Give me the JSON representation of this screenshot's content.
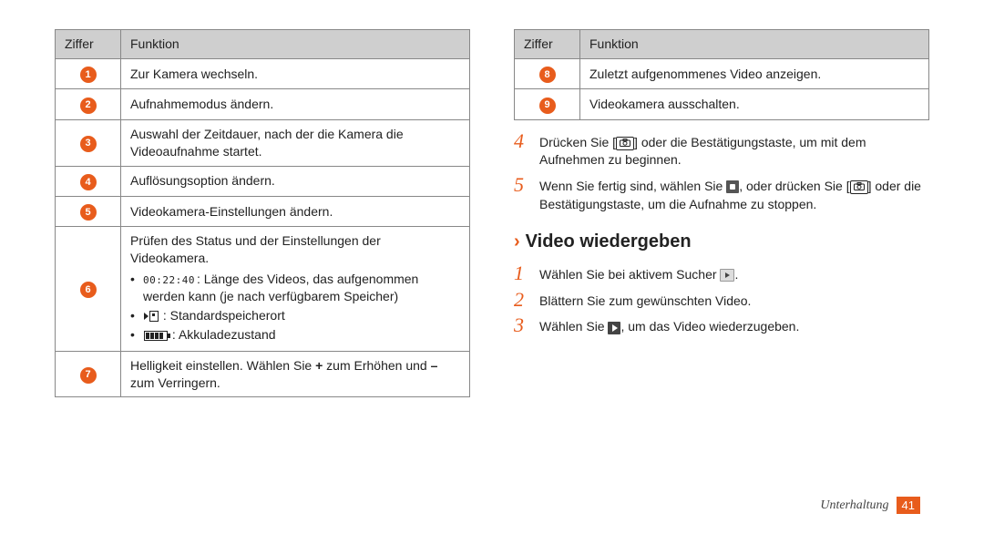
{
  "table_header": {
    "col1": "Ziffer",
    "col2": "Funktion"
  },
  "left_rows": [
    {
      "num": "1",
      "text": "Zur Kamera wechseln."
    },
    {
      "num": "2",
      "text": "Aufnahmemodus ändern."
    },
    {
      "num": "3",
      "text": "Auswahl der Zeitdauer, nach der die Kamera die Videoaufnahme startet."
    },
    {
      "num": "4",
      "text": "Auflösungsoption ändern."
    },
    {
      "num": "5",
      "text": "Videokamera-Einstellungen ändern."
    }
  ],
  "row6": {
    "num": "6",
    "intro": "Prüfen des Status und der Einstellungen der Videokamera.",
    "bullet1_time": "00:22:40",
    "bullet1_rest": ": Länge des Videos, das aufgenommen werden kann (je nach verfügbarem Speicher)",
    "bullet2": ": Standardspeicherort",
    "bullet3": ": Akkuladezustand"
  },
  "row7": {
    "num": "7",
    "pre": "Helligkeit einstellen. Wählen Sie ",
    "plus": "+",
    "mid": " zum Erhöhen und ",
    "minus": "–",
    "post": " zum Verringern."
  },
  "right_rows": [
    {
      "num": "8",
      "text": "Zuletzt aufgenommenes Video anzeigen."
    },
    {
      "num": "9",
      "text": "Videokamera ausschalten."
    }
  ],
  "step4": {
    "num": "4",
    "pre": "Drücken Sie [",
    "post": "] oder die Bestätigungstaste, um mit dem Aufnehmen zu beginnen."
  },
  "step5": {
    "num": "5",
    "pre": "Wenn Sie fertig sind, wählen Sie ",
    "mid": ", oder drücken Sie [",
    "post": "] oder die Bestätigungstaste, um die Aufnahme zu stoppen."
  },
  "heading": "Video wiedergeben",
  "play_step1": {
    "num": "1",
    "pre": "Wählen Sie bei aktivem Sucher ",
    "post": "."
  },
  "play_step2": {
    "num": "2",
    "text": "Blättern Sie zum gewünschten Video."
  },
  "play_step3": {
    "num": "3",
    "pre": "Wählen Sie ",
    "post": ", um das Video wiederzugeben."
  },
  "footer": {
    "section": "Unterhaltung",
    "page": "41"
  }
}
